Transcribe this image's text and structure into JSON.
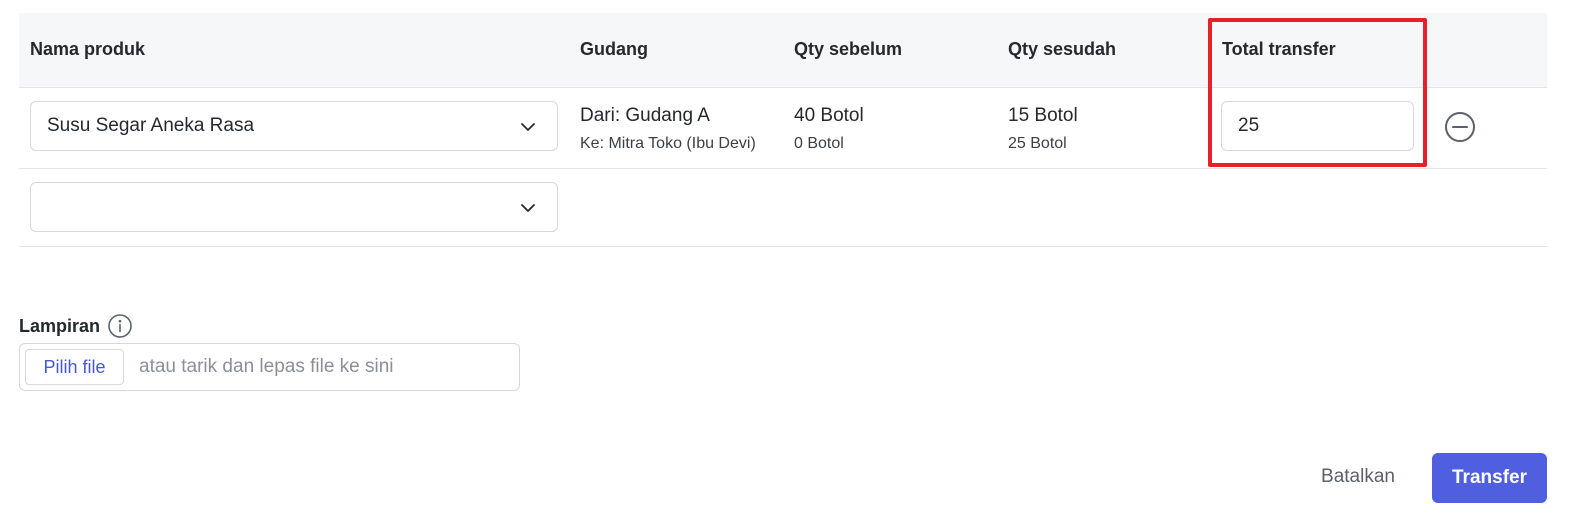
{
  "table": {
    "headers": {
      "product": "Nama produk",
      "warehouse": "Gudang",
      "qty_before": "Qty sebelum",
      "qty_after": "Qty sesudah",
      "total_transfer": "Total transfer"
    },
    "rows": [
      {
        "product": "Susu Segar Aneka Rasa",
        "warehouse_from": "Dari: Gudang A",
        "warehouse_to": "Ke: Mitra Toko (Ibu Devi)",
        "qty_before_main": "40 Botol",
        "qty_before_sub": "0 Botol",
        "qty_after_main": "15 Botol",
        "qty_after_sub": "25 Botol",
        "total_transfer": "25"
      },
      {
        "product": ""
      }
    ]
  },
  "attachment": {
    "label": "Lampiran",
    "choose_file": "Pilih file",
    "placeholder": "atau tarik dan lepas file ke sini"
  },
  "footer": {
    "cancel": "Batalkan",
    "submit": "Transfer"
  },
  "colors": {
    "primary": "#4f5fe0",
    "highlight": "#e8202a",
    "link": "#4658d6"
  },
  "icons": {
    "select": "chevron-down-icon",
    "remove": "minus-circle-icon",
    "info": "info-icon"
  }
}
